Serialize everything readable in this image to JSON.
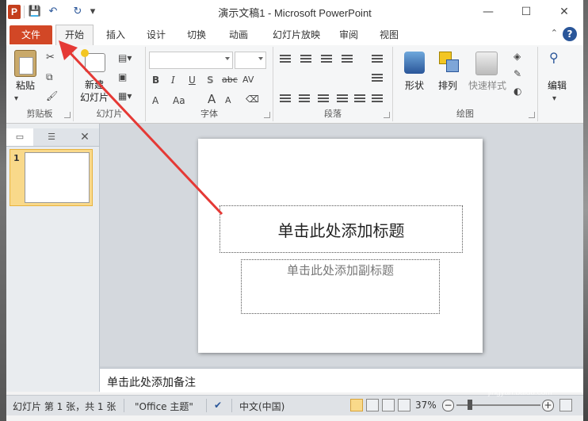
{
  "window": {
    "app_logo": "P",
    "title": "演示文稿1 - Microsoft PowerPoint",
    "controls": {
      "minimize": "—",
      "maximize": "☐",
      "close": "✕"
    }
  },
  "qat": {
    "save": "💾",
    "undo": "↶",
    "redo": "↻",
    "customize": "▾"
  },
  "tabs": [
    {
      "label": "文件"
    },
    {
      "label": "开始"
    },
    {
      "label": "插入"
    },
    {
      "label": "设计"
    },
    {
      "label": "切换"
    },
    {
      "label": "动画"
    },
    {
      "label": "幻灯片放映"
    },
    {
      "label": "审阅"
    },
    {
      "label": "视图"
    }
  ],
  "ribbon": {
    "clipboard": {
      "group": "剪贴板",
      "paste": "粘贴"
    },
    "slides": {
      "group": "幻灯片",
      "new_slide_line1": "新建",
      "new_slide_line2": "幻灯片"
    },
    "font": {
      "group": "字体",
      "bold": "B",
      "italic": "I",
      "underline": "U",
      "shadow": "S",
      "strike": "abc",
      "spacing": "AV",
      "font_color": "A",
      "case": "Aa",
      "grow": "A",
      "shrink": "A"
    },
    "paragraph": {
      "group": "段落"
    },
    "drawing": {
      "group": "绘图",
      "shapes": "形状",
      "arrange": "排列",
      "quick_styles": "快速样式"
    },
    "editing": {
      "group": "",
      "label": "编辑"
    }
  },
  "pane": {
    "slide_number": "1",
    "close": "✕"
  },
  "slide": {
    "title_placeholder": "单击此处添加标题",
    "subtitle_placeholder": "单击此处添加副标题"
  },
  "notes": {
    "placeholder": "单击此处添加备注"
  },
  "status": {
    "slide_info": "幻灯片 第 1 张，共 1 张",
    "theme": "\"Office 主题\"",
    "language": "中文(中国)",
    "zoom": "37%"
  },
  "watermark": {
    "brand": "Baidu经验",
    "url": "jingyan.baidu.com"
  },
  "colors": {
    "file_tab": "#d24726",
    "accent": "#2a5699",
    "annotation_arrow": "#e53935"
  }
}
